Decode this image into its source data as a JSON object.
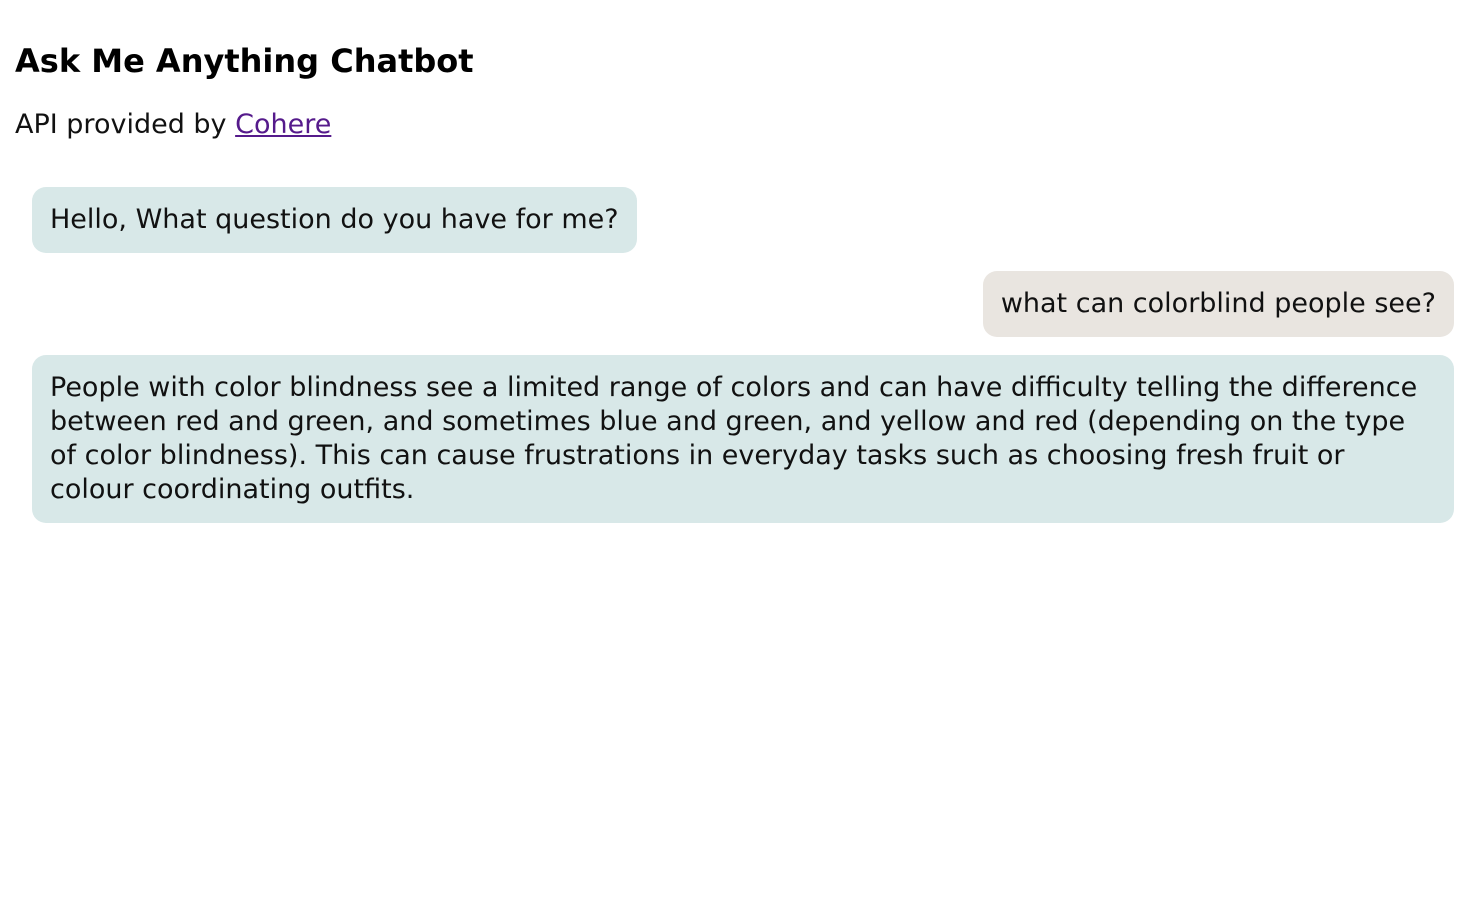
{
  "header": {
    "title": "Ask Me Anything Chatbot",
    "api_prefix": "API provided by ",
    "api_link_label": "Cohere"
  },
  "colors": {
    "bot_bubble": "#d8e8e8",
    "user_bubble": "#e9e5e0",
    "link": "#551a8b"
  },
  "messages": [
    {
      "role": "bot",
      "text": "Hello, What question do you have for me?"
    },
    {
      "role": "user",
      "text": "what can colorblind people see?"
    },
    {
      "role": "bot",
      "text": "People with color blindness see a limited range of colors and can have difficulty telling the difference between red and green, and sometimes blue and green, and yellow and red (depending on the type of color blindness). This can cause frustrations in everyday tasks such as choosing fresh fruit or colour coordinating outfits."
    }
  ]
}
